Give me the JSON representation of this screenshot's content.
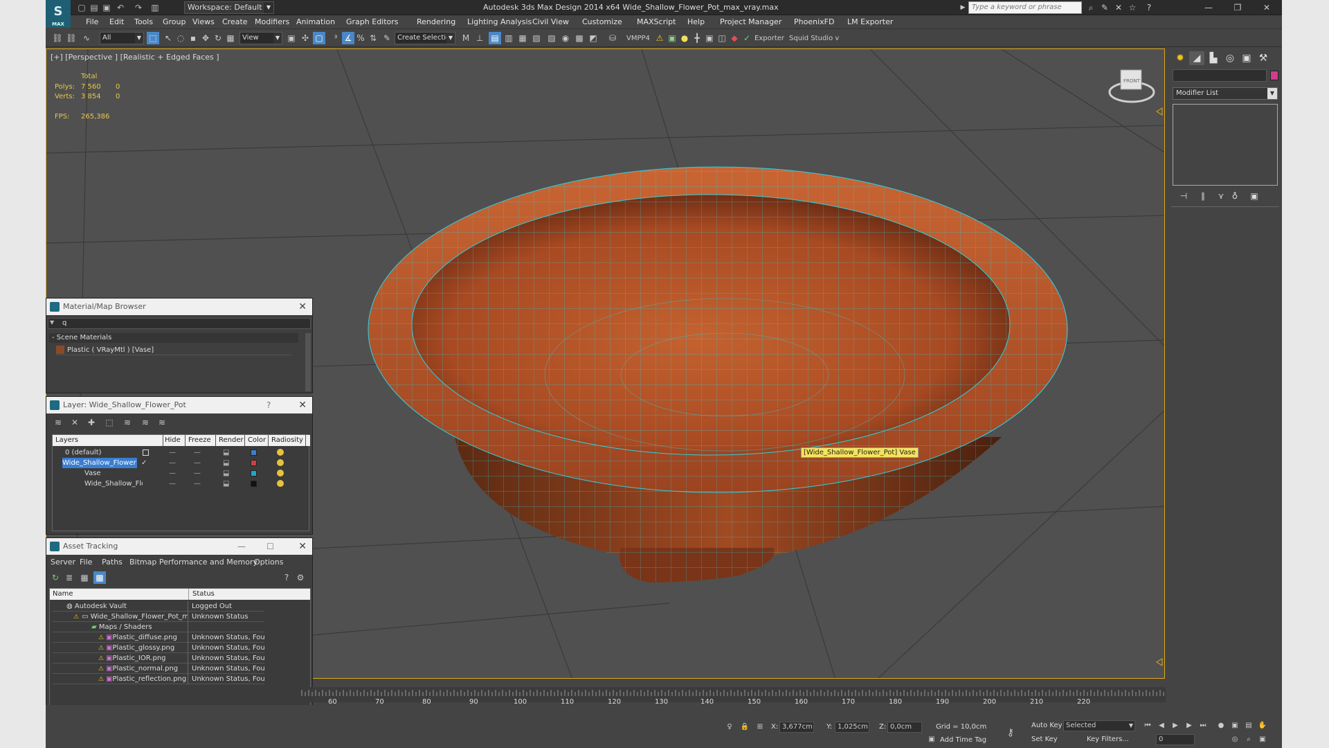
{
  "app": {
    "logo_text": "MAX",
    "title": "Autodesk 3ds Max Design 2014 x64     Wide_Shallow_Flower_Pot_max_vray.max",
    "workspace": "Workspace: Default",
    "search_placeholder": "Type a keyword or phrase"
  },
  "menus": [
    "File",
    "Edit",
    "Tools",
    "Group",
    "Views",
    "Create",
    "Modifiers",
    "Animation",
    "Graph Editors",
    "Rendering",
    "Lighting Analysis",
    "Civil View",
    "Customize",
    "MAXScript",
    "Help",
    "Project Manager",
    "PhoenixFD",
    "LM Exporter"
  ],
  "toolbar": {
    "selection_filter": "All",
    "ref_coord": "View",
    "named_selection": "Create Selection Se",
    "vmpp_label": "VMPP4",
    "exporter_label": "Exporter",
    "squid_label": "Squid Studio v"
  },
  "viewport": {
    "label": "[+] [Perspective ] [Realistic + Edged Faces ]",
    "stats_header": "Total",
    "polys_label": "Polys:",
    "polys_total": "7 560",
    "polys_sel": "0",
    "verts_label": "Verts:",
    "verts_total": "3 854",
    "verts_sel": "0",
    "fps_label": "FPS:",
    "fps_value": "265,386",
    "tooltip": "[Wide_Shallow_Flower_Pot] Vase",
    "viewcube_label": "FRONT"
  },
  "command_panel": {
    "modifier_list": "Modifier List",
    "object_color": "#d13d8b"
  },
  "material_browser": {
    "title": "Material/Map Browser",
    "search_value": "q",
    "group": "- Scene Materials",
    "item": "Plastic ( VRayMtl ) [Vase]"
  },
  "layer_manager": {
    "title": "Layer: Wide_Shallow_Flower_Pot",
    "help": "?",
    "columns": [
      "Layers",
      "Hide",
      "Freeze",
      "Render",
      "Color",
      "Radiosity"
    ],
    "rows": [
      {
        "name": "0 (default)",
        "color": "#3a7fd0"
      },
      {
        "name": "Wide_Shallow_Flower",
        "color": "#d04040"
      },
      {
        "name": "Vase",
        "color": "#1fa8c7"
      },
      {
        "name": "Wide_Shallow_Flo",
        "color": "#111111"
      }
    ]
  },
  "asset_tracking": {
    "title": "Asset Tracking",
    "menus": [
      "Server",
      "File",
      "Paths",
      "Bitmap Performance and Memory",
      "Options"
    ],
    "col_name": "Name",
    "col_status": "Status",
    "rows": [
      {
        "name": "Autodesk Vault",
        "status": "Logged Out"
      },
      {
        "name": "Wide_Shallow_Flower_Pot_max_vr...",
        "status": "Unknown Status"
      },
      {
        "name": "Maps / Shaders",
        "status": ""
      },
      {
        "name": "Plastic_diffuse.png",
        "status": "Unknown Status, Found"
      },
      {
        "name": "Plastic_glossy.png",
        "status": "Unknown Status, Found"
      },
      {
        "name": "Plastic_IOR.png",
        "status": "Unknown Status, Found"
      },
      {
        "name": "Plastic_normal.png",
        "status": "Unknown Status, Found"
      },
      {
        "name": "Plastic_reflection.png",
        "status": "Unknown Status, Found"
      }
    ]
  },
  "timeline": {
    "ticks": [
      "60",
      "70",
      "80",
      "90",
      "100",
      "110",
      "120",
      "130",
      "140",
      "150",
      "160",
      "170",
      "180",
      "190",
      "200",
      "210",
      "220"
    ]
  },
  "status_bar": {
    "x_label": "X:",
    "x_value": "3,677cm",
    "y_label": "Y:",
    "y_value": "1,025cm",
    "z_label": "Z:",
    "z_value": "0,0cm",
    "grid": "Grid = 10,0cm",
    "auto_key": "Auto Key",
    "set_key": "Set Key",
    "selected": "Selected",
    "key_filters": "Key Filters...",
    "add_time_tag": "Add Time Tag",
    "frame": "0"
  },
  "colors": {
    "viewport_border": "#e2a81d",
    "pot": "#b5552a",
    "wire": "#2bd3e6"
  }
}
